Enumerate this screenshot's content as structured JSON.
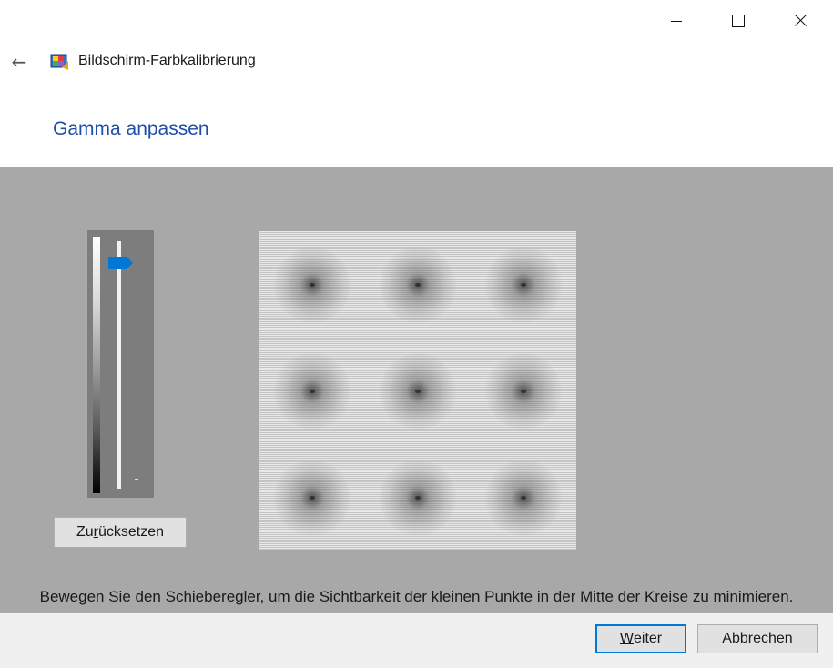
{
  "window": {
    "title": "Bildschirm-Farbkalibrierung",
    "controls": [
      "minimize-icon",
      "maximize-icon",
      "close-icon"
    ]
  },
  "page": {
    "heading": "Gamma anpassen",
    "instruction": "Bewegen Sie den Schieberegler, um die Sichtbarkeit der kleinen Punkte in der Mitte der Kreise zu minimieren."
  },
  "slider": {
    "level": 0.06,
    "reset_label_pre": "Zu",
    "reset_label_key": "r",
    "reset_label_post": "ücksetzen"
  },
  "footer": {
    "next_key": "W",
    "next_rest": "eiter",
    "cancel_label": "Abbrechen"
  },
  "colors": {
    "heading": "#1f4ea8",
    "calibration_background": "#a8a8a8",
    "accent": "#0078d7"
  }
}
